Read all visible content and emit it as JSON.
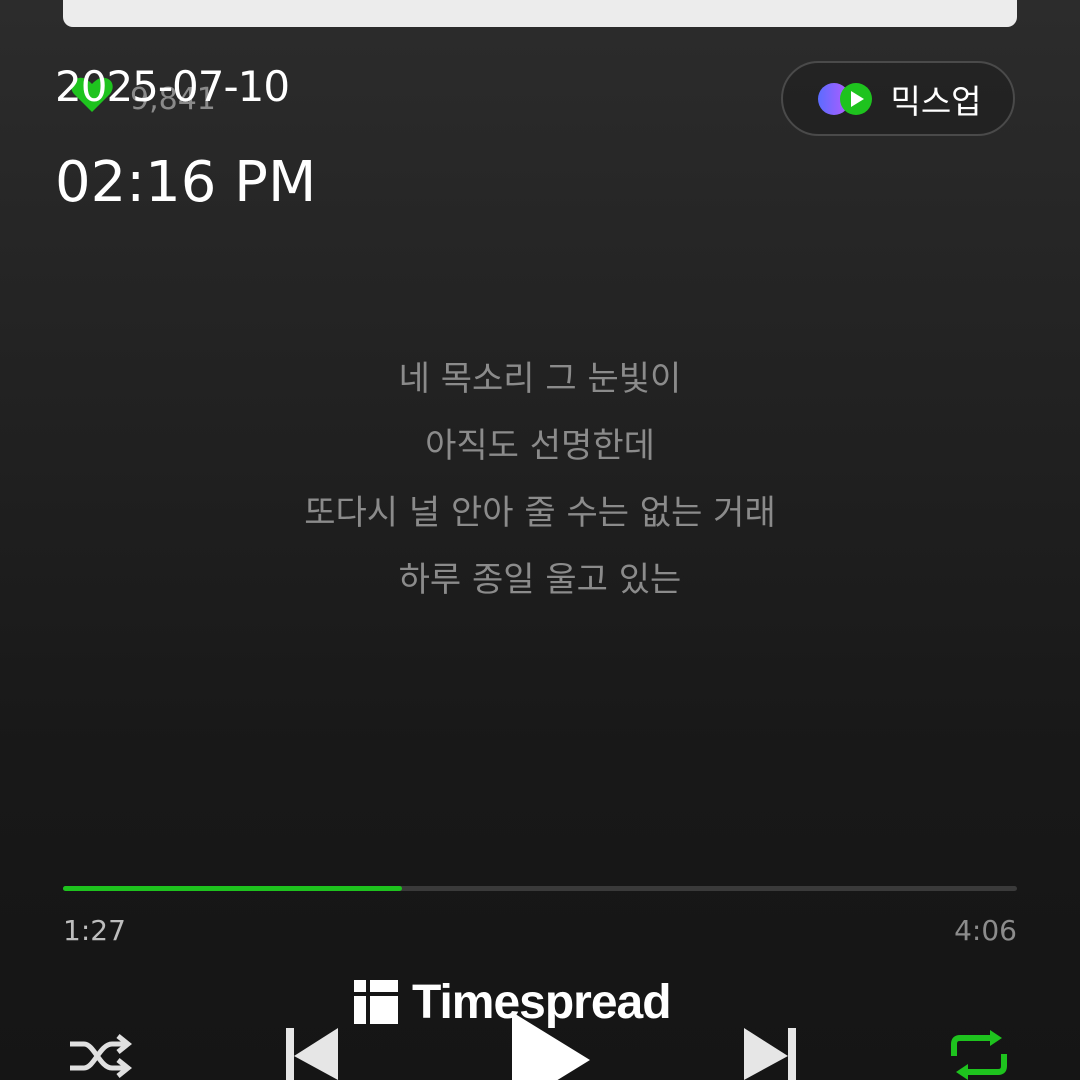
{
  "player": {
    "like_count": "9,841",
    "mixup_label": "믹스업",
    "lyrics": [
      "네 목소리 그 눈빛이",
      "아직도 선명한데",
      "또다시 널 안아 줄 수는 없는 거래",
      "하루 종일 울고 있는"
    ],
    "elapsed": "1:27",
    "total": "4:06",
    "progress_fraction": 0.355
  },
  "overlay": {
    "date": "2025-07-10",
    "time": "02:16 PM",
    "watermark": "Timespread"
  },
  "icons": {
    "like": "heart-icon",
    "mixup": "mixup-logo-icon",
    "shuffle": "shuffle-icon",
    "previous": "previous-track-icon",
    "play": "play-icon",
    "next": "next-track-icon",
    "repeat": "repeat-icon",
    "watermark": "timespread-logo-icon"
  },
  "colors": {
    "accent": "#1ec31e",
    "background": "#1c1c1c"
  }
}
